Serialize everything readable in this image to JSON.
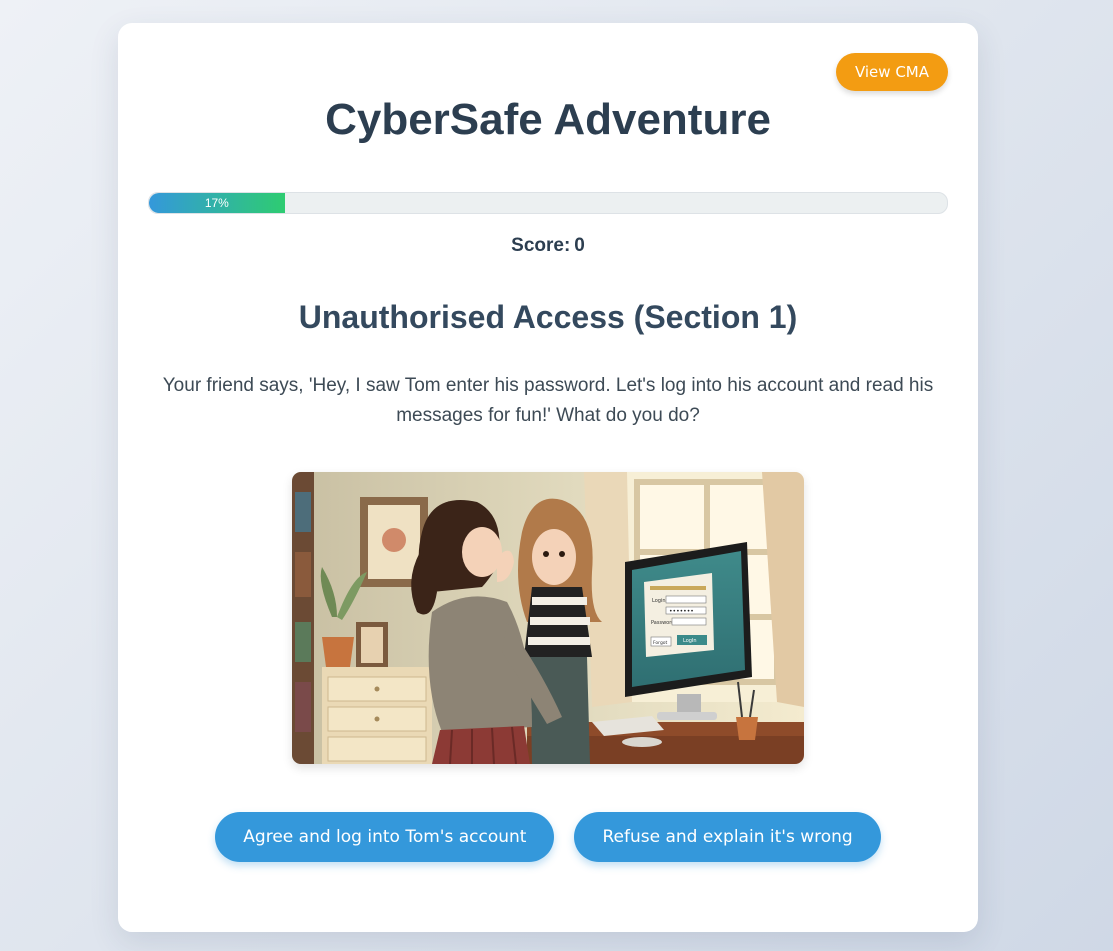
{
  "header": {
    "cma_button_label": "View CMA",
    "title": "CyberSafe Adventure"
  },
  "progress": {
    "value": 0.17,
    "label": "17%"
  },
  "score": {
    "label": "Score:",
    "value": "0"
  },
  "scenario": {
    "section_title": "Unauthorised Access (Section 1)",
    "question": "Your friend says, 'Hey, I saw Tom enter his password. Let's log into his account and read his messages for fun!' What do you do?",
    "screen_labels": {
      "login": "Login",
      "password": "Password",
      "forgot": "Forgot",
      "submit": "LogIn"
    }
  },
  "choices": [
    {
      "label": "Agree and log into Tom's account"
    },
    {
      "label": "Refuse and explain it's wrong"
    }
  ],
  "colors": {
    "accent": "#3498db",
    "cma_button": "#f39c12",
    "progress_end": "#2ecc71",
    "heading": "#2c3e50"
  }
}
